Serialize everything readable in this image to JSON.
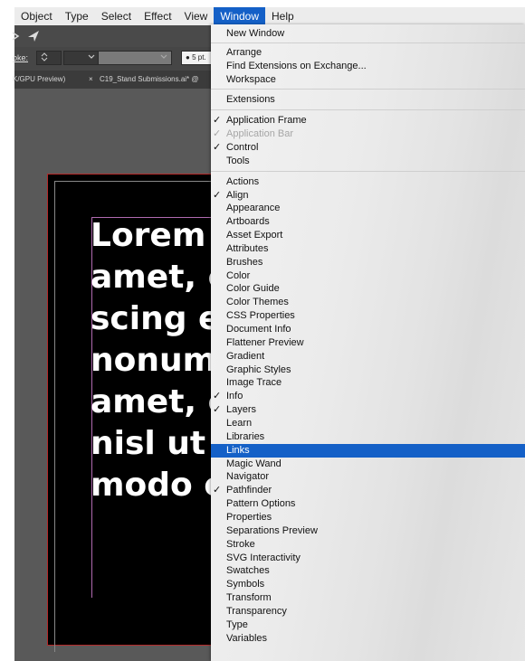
{
  "menubar": {
    "items": [
      "Object",
      "Type",
      "Select",
      "Effect",
      "View",
      "Window",
      "Help"
    ],
    "active_index": 5,
    "active_color": "#1460c7"
  },
  "control_bar": {
    "stroke_label": "oke:",
    "brush_size": "5 pt."
  },
  "tabs": [
    "K/GPU Preview)",
    "C19_Stand Submissions.ai* @"
  ],
  "tab_close_glyph": "×",
  "artboard_text": [
    "Lorem i",
    "amet, c",
    "scing el",
    "nonumm",
    "amet, c",
    "nisl ut a",
    "modo c"
  ],
  "window_menu": {
    "group1": [
      {
        "label": "New Window",
        "checked": false
      }
    ],
    "group2": [
      {
        "label": "Arrange",
        "checked": false
      },
      {
        "label": "Find Extensions on Exchange...",
        "checked": false
      },
      {
        "label": "Workspace",
        "checked": false
      }
    ],
    "group3": [
      {
        "label": "Extensions",
        "checked": false
      }
    ],
    "group4": [
      {
        "label": "Application Frame",
        "checked": true
      },
      {
        "label": "Application Bar",
        "checked": true,
        "disabled": true
      },
      {
        "label": "Control",
        "checked": true
      },
      {
        "label": "Tools",
        "checked": false
      }
    ],
    "panels": [
      {
        "label": "Actions",
        "checked": false
      },
      {
        "label": "Align",
        "checked": true
      },
      {
        "label": "Appearance",
        "checked": false
      },
      {
        "label": "Artboards",
        "checked": false
      },
      {
        "label": "Asset Export",
        "checked": false
      },
      {
        "label": "Attributes",
        "checked": false
      },
      {
        "label": "Brushes",
        "checked": false
      },
      {
        "label": "Color",
        "checked": false
      },
      {
        "label": "Color Guide",
        "checked": false
      },
      {
        "label": "Color Themes",
        "checked": false
      },
      {
        "label": "CSS Properties",
        "checked": false
      },
      {
        "label": "Document Info",
        "checked": false
      },
      {
        "label": "Flattener Preview",
        "checked": false
      },
      {
        "label": "Gradient",
        "checked": false
      },
      {
        "label": "Graphic Styles",
        "checked": false
      },
      {
        "label": "Image Trace",
        "checked": false
      },
      {
        "label": "Info",
        "checked": true
      },
      {
        "label": "Layers",
        "checked": true
      },
      {
        "label": "Learn",
        "checked": false
      },
      {
        "label": "Libraries",
        "checked": false
      },
      {
        "label": "Links",
        "checked": false,
        "highlighted": true
      },
      {
        "label": "Magic Wand",
        "checked": false
      },
      {
        "label": "Navigator",
        "checked": false
      },
      {
        "label": "Pathfinder",
        "checked": true
      },
      {
        "label": "Pattern Options",
        "checked": false
      },
      {
        "label": "Properties",
        "checked": false
      },
      {
        "label": "Separations Preview",
        "checked": false
      },
      {
        "label": "Stroke",
        "checked": false
      },
      {
        "label": "SVG Interactivity",
        "checked": false
      },
      {
        "label": "Swatches",
        "checked": false
      },
      {
        "label": "Symbols",
        "checked": false
      },
      {
        "label": "Transform",
        "checked": false
      },
      {
        "label": "Transparency",
        "checked": false
      },
      {
        "label": "Type",
        "checked": false
      },
      {
        "label": "Variables",
        "checked": false
      }
    ],
    "check_glyph": "✓",
    "highlight_color": "#1460c7"
  }
}
